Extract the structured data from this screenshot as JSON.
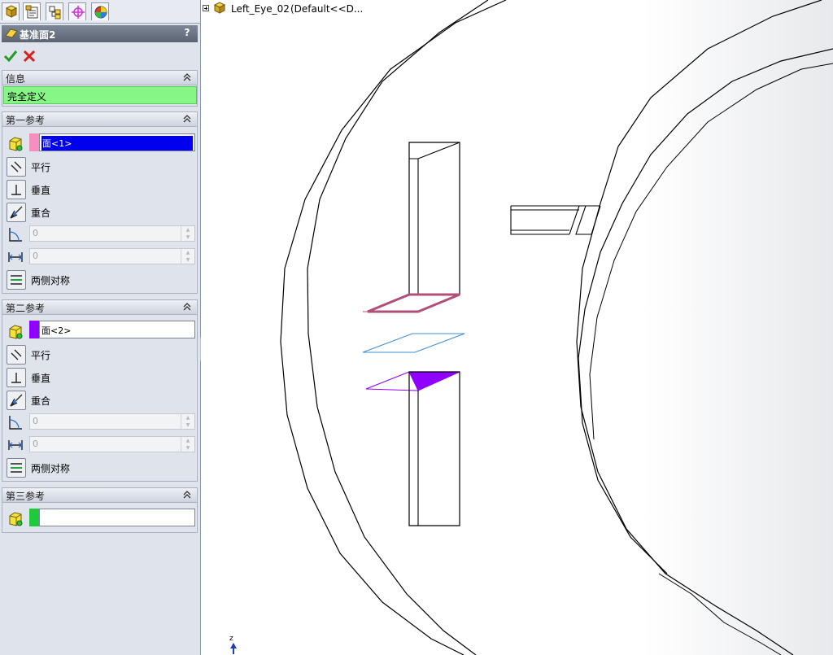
{
  "feature_manager_tabs": [
    {
      "icon": "feature-tree-icon"
    },
    {
      "icon": "property-manager-icon"
    },
    {
      "icon": "configuration-manager-icon"
    },
    {
      "icon": "dimxpert-icon"
    },
    {
      "icon": "display-manager-icon"
    }
  ],
  "property_manager": {
    "title": "基准面2",
    "help": "?",
    "groups": {
      "info": {
        "label": "信息",
        "status": "完全定义",
        "status_color": "#86f786"
      },
      "first_reference": {
        "label": "第一参考",
        "selection": "面<1>",
        "swatch_color": "#f58fbf",
        "options": {
          "parallel": "平行",
          "perpendicular": "垂直",
          "coincident": "重合",
          "angle_value": "0",
          "distance_value": "0",
          "mid_plane": "两侧对称"
        }
      },
      "second_reference": {
        "label": "第二参考",
        "selection": "面<2>",
        "swatch_color": "#8f00ff",
        "options": {
          "parallel": "平行",
          "perpendicular": "垂直",
          "coincident": "重合",
          "angle_value": "0",
          "distance_value": "0",
          "mid_plane": "两侧对称"
        }
      },
      "third_reference": {
        "label": "第三参考",
        "selection": "",
        "swatch_color": "#1fc93c"
      }
    }
  },
  "graphics_area": {
    "tree_part_name": "Left_Eye_02",
    "tree_config": "(Default<<D...",
    "triad_axis": "z"
  },
  "colors": {
    "first_ref_highlight": "#b0507a",
    "second_ref_highlight": "#8f00ff",
    "plane_preview": "#3f8fcf",
    "active_selection": "#0000ee"
  }
}
